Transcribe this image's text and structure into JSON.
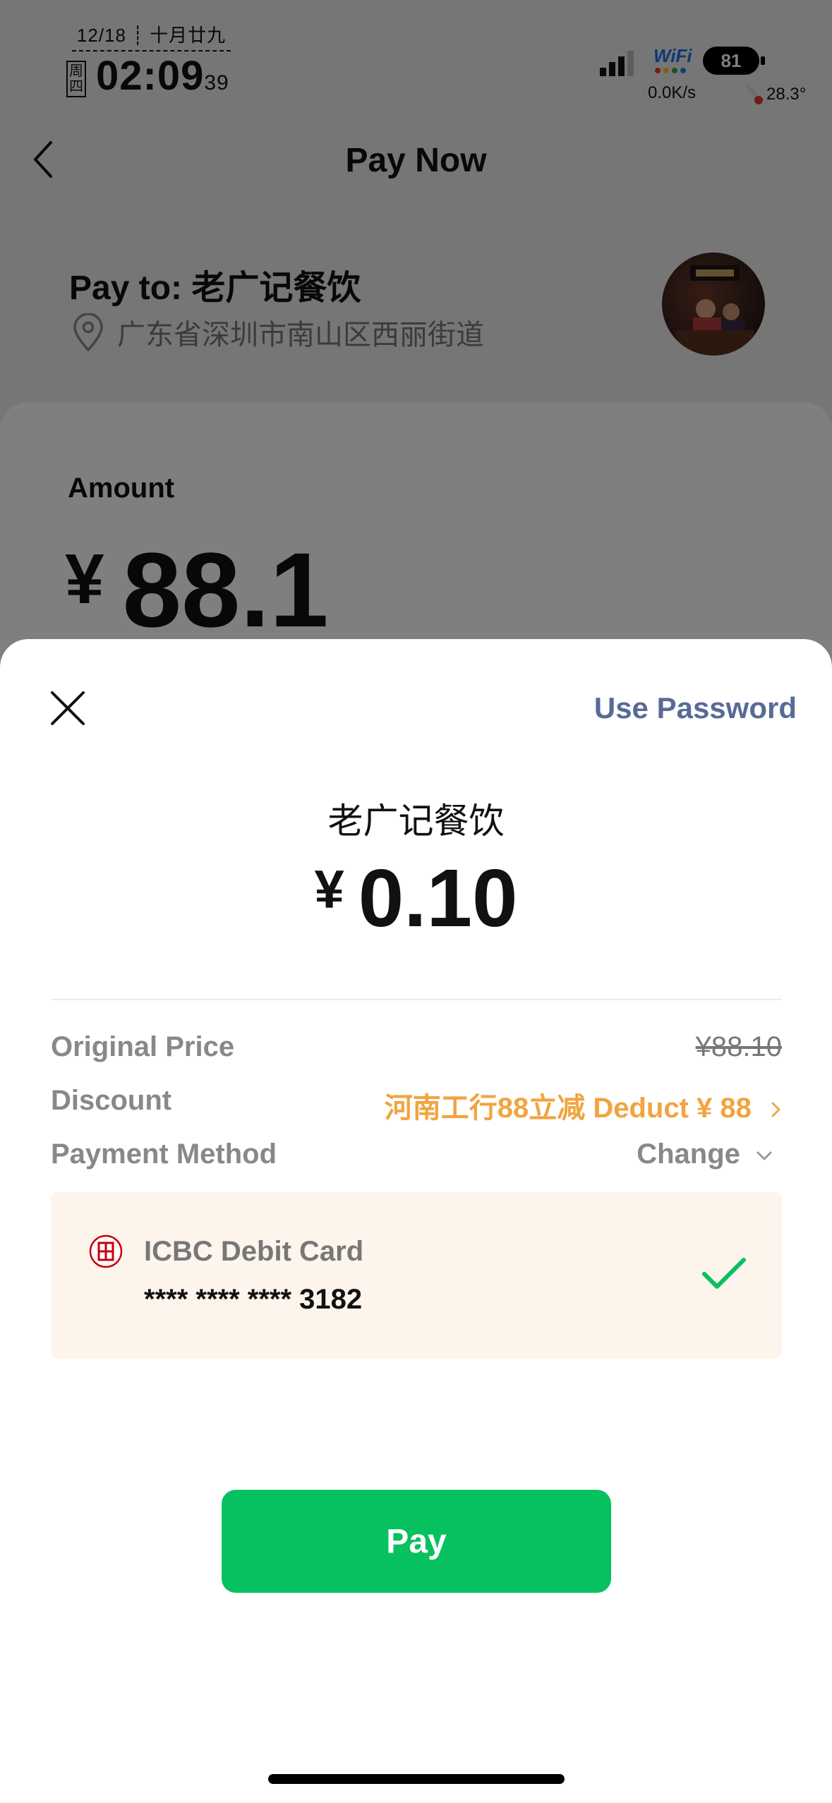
{
  "status_bar": {
    "date": "12/18 ┊ 十月廿九",
    "weekday": "周四",
    "time": "02:09",
    "seconds": "39",
    "wifi_label": "WiFi",
    "battery": "81",
    "net_speed": "0.0K/s",
    "temperature": "28.3°"
  },
  "background": {
    "nav_title": "Pay Now",
    "pay_to": "Pay to: 老广记餐饮",
    "address": "广东省深圳市南山区西丽街道",
    "amount_label": "Amount",
    "amount_currency": "¥",
    "amount_value": "88.1"
  },
  "sheet": {
    "use_password": "Use Password",
    "merchant": "老广记餐饮",
    "amount_currency": "¥",
    "amount_value": "0.10",
    "rows": {
      "original_price_label": "Original Price",
      "original_price_value": "¥88.10",
      "discount_label": "Discount",
      "discount_value": "河南工行88立减 Deduct ¥ 88",
      "payment_method_label": "Payment Method",
      "payment_method_action": "Change"
    },
    "card": {
      "bank_name": "ICBC Debit Card",
      "card_number": "**** **** **** 3182",
      "selected": true
    },
    "pay_button": "Pay"
  },
  "colors": {
    "accent_green": "#07c160",
    "link_blue": "#576b95",
    "discount_orange": "#f1a440",
    "card_bg": "#fdf5ec",
    "icbc_red": "#c7000b"
  },
  "icons": [
    "back-chevron-icon",
    "location-pin-icon",
    "close-icon",
    "chevron-right-icon",
    "chevron-down-icon",
    "icbc-logo-icon",
    "checkmark-icon"
  ]
}
